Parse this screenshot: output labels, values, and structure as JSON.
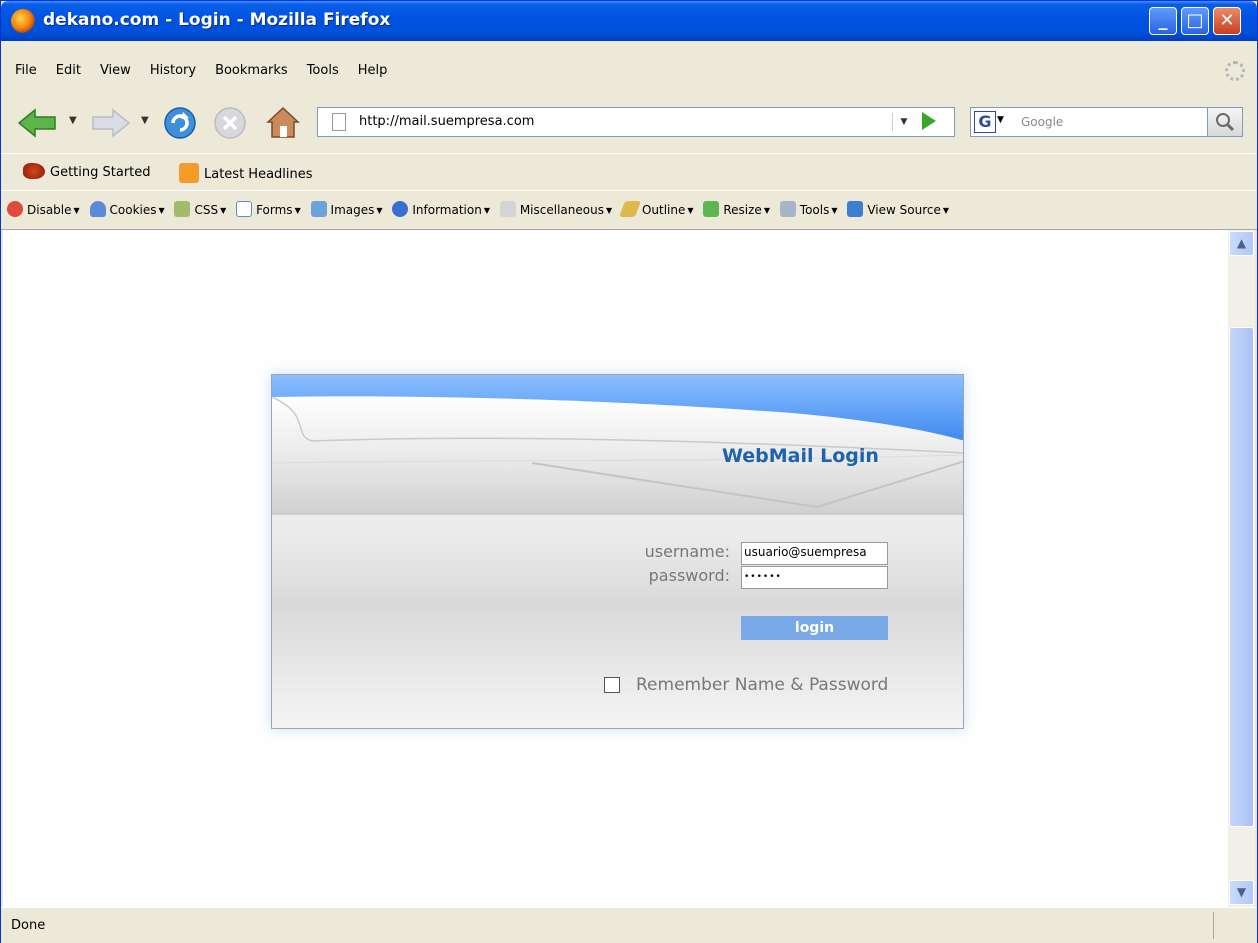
{
  "window": {
    "title": "dekano.com - Login - Mozilla Firefox"
  },
  "menu": {
    "items": [
      "File",
      "Edit",
      "View",
      "History",
      "Bookmarks",
      "Tools",
      "Help"
    ]
  },
  "nav": {
    "url": "http://mail.suempresa.com",
    "search_placeholder": "Google"
  },
  "bookmarks": {
    "items": [
      "Getting Started",
      "Latest Headlines"
    ]
  },
  "devtoolbar": {
    "items": [
      "Disable",
      "Cookies",
      "CSS",
      "Forms",
      "Images",
      "Information",
      "Miscellaneous",
      "Outline",
      "Resize",
      "Tools",
      "View Source"
    ]
  },
  "login": {
    "heading": "WebMail Login",
    "username_label": "username:",
    "username_value": "usuario@suempresa",
    "password_label": "password:",
    "password_value": "••••••",
    "login_button": "login",
    "remember_label": "Remember Name & Password",
    "remember_checked": false
  },
  "status": {
    "text": "Done"
  },
  "colors": {
    "titlebar": "#0054e3",
    "accent": "#1d63ae",
    "login_button": "#79a9e8"
  }
}
